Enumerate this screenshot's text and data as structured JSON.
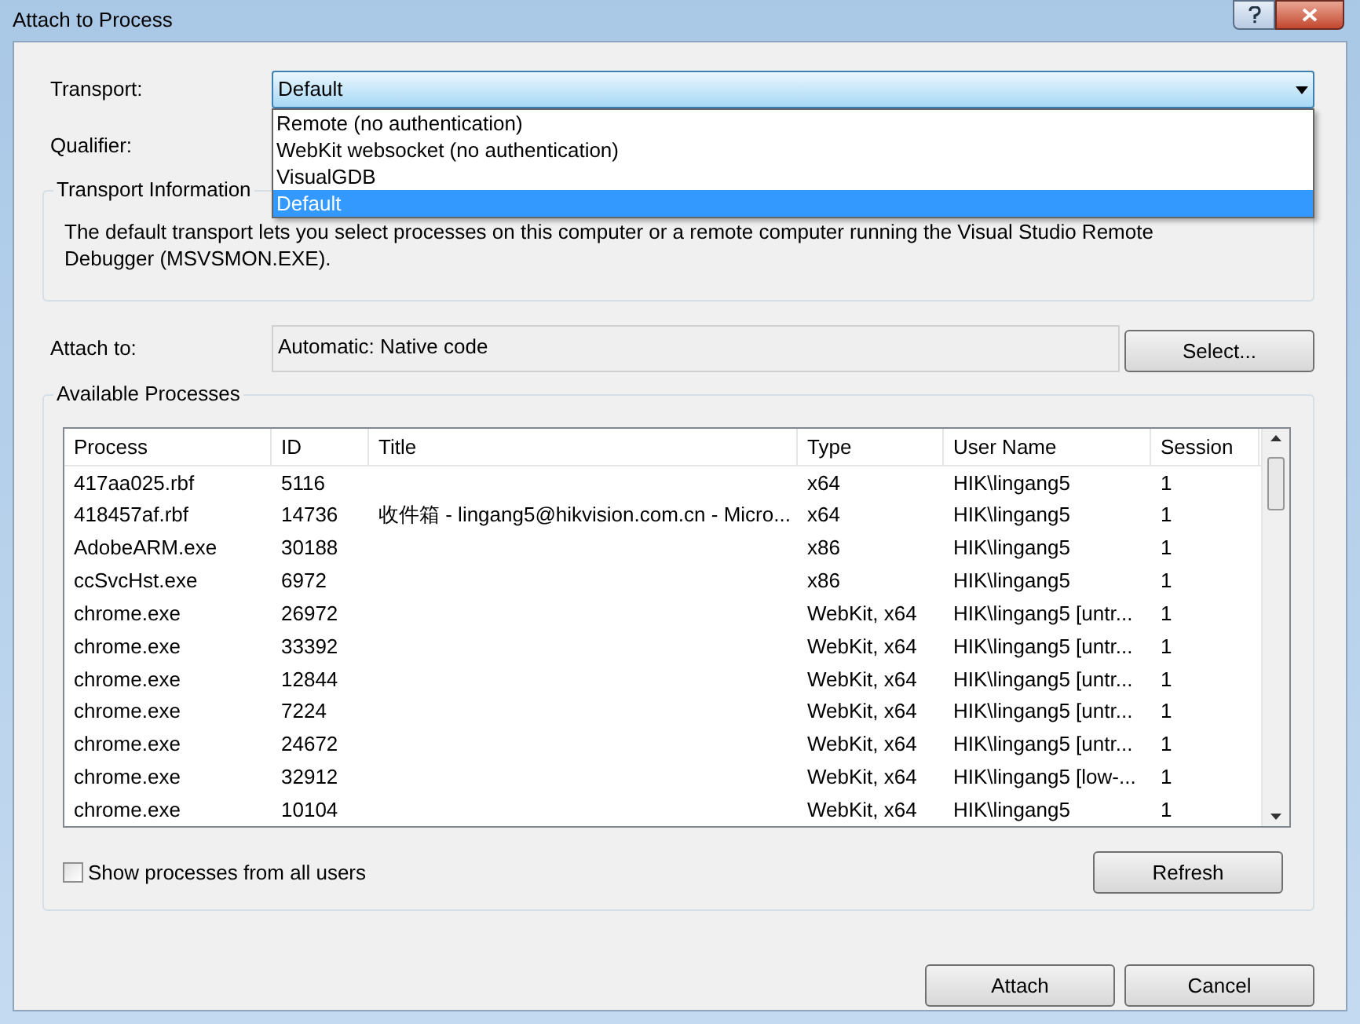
{
  "window": {
    "title": "Attach to Process"
  },
  "transport": {
    "label": "Transport:",
    "value": "Default",
    "expanded": true,
    "options": [
      {
        "label": "Remote (no authentication)",
        "selected": false
      },
      {
        "label": "WebKit websocket (no authentication)",
        "selected": false
      },
      {
        "label": "VisualGDB",
        "selected": false
      },
      {
        "label": "Default",
        "selected": true
      }
    ]
  },
  "qualifier": {
    "label": "Qualifier:"
  },
  "transport_information": {
    "title": "Transport Information",
    "text": "The default transport lets you select processes on this computer or a remote computer running the Visual Studio Remote Debugger (MSVSMON.EXE)."
  },
  "attach_to": {
    "label": "Attach to:",
    "value": "Automatic: Native code",
    "button": "Select..."
  },
  "available_processes": {
    "title": "Available Processes",
    "columns": [
      "Process",
      "ID",
      "Title",
      "Type",
      "User Name",
      "Session"
    ],
    "rows": [
      [
        "417aa025.rbf",
        "5116",
        "",
        "x64",
        "HIK\\lingang5",
        "1"
      ],
      [
        "418457af.rbf",
        "14736",
        "收件箱 - lingang5@hikvision.com.cn - Micro...",
        "x64",
        "HIK\\lingang5",
        "1"
      ],
      [
        "AdobeARM.exe",
        "30188",
        "",
        "x86",
        "HIK\\lingang5",
        "1"
      ],
      [
        "ccSvcHst.exe",
        "6972",
        "",
        "x86",
        "HIK\\lingang5",
        "1"
      ],
      [
        "chrome.exe",
        "26972",
        "",
        "WebKit, x64",
        "HIK\\lingang5 [untr...",
        "1"
      ],
      [
        "chrome.exe",
        "33392",
        "",
        "WebKit, x64",
        "HIK\\lingang5 [untr...",
        "1"
      ],
      [
        "chrome.exe",
        "12844",
        "",
        "WebKit, x64",
        "HIK\\lingang5 [untr...",
        "1"
      ],
      [
        "chrome.exe",
        "7224",
        "",
        "WebKit, x64",
        "HIK\\lingang5 [untr...",
        "1"
      ],
      [
        "chrome.exe",
        "24672",
        "",
        "WebKit, x64",
        "HIK\\lingang5 [untr...",
        "1"
      ],
      [
        "chrome.exe",
        "32912",
        "",
        "WebKit, x64",
        "HIK\\lingang5 [low-...",
        "1"
      ],
      [
        "chrome.exe",
        "10104",
        "",
        "WebKit, x64",
        "HIK\\lingang5",
        "1"
      ]
    ],
    "show_all": {
      "label": "Show processes from all users",
      "checked": false
    },
    "refresh": "Refresh"
  },
  "buttons": [
    "Attach",
    "Cancel"
  ]
}
